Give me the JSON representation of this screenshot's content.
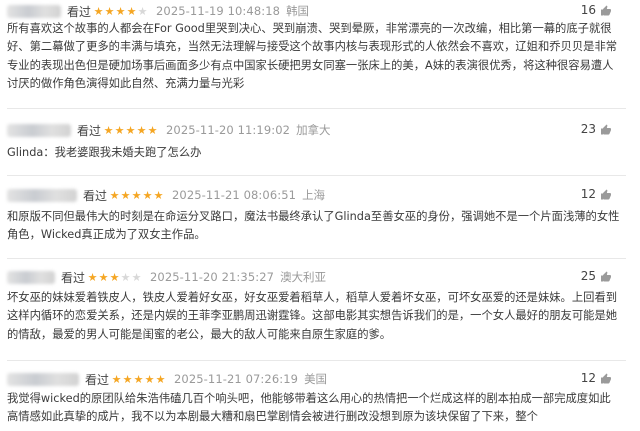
{
  "reviews": [
    {
      "watched_label": "看过",
      "rating": 4,
      "date": "2025-11-19 10:48:18",
      "location": "韩国",
      "likes": "16",
      "text": "所有喜欢这个故事的人都会在For Good里哭到决心、哭到崩溃、哭到晕厥，非常漂亮的一次改编，相比第一幕的底子就很好、第二幕做了更多的丰满与填充，当然无法理解与接受这个故事内核与表现形式的人依然会不喜欢，辽姐和乔贝贝是非常专业的表现出色但是硬加场事后画面多少有点中国家长硬把男女同塞一张床上的美，A妹的表演很优秀，将这种很容易遭人讨厌的做作角色演得如此自然、充满力量与光彩"
    },
    {
      "watched_label": "看过",
      "rating": 5,
      "date": "2025-11-20 11:19:02",
      "location": "加拿大",
      "likes": "23",
      "text": "Glinda：我老婆跟我未婚夫跑了怎么办"
    },
    {
      "watched_label": "看过",
      "rating": 5,
      "date": "2025-11-21 08:06:51",
      "location": "上海",
      "likes": "12",
      "text": "和原版不同但最伟大的时刻是在命运分叉路口，魔法书最终承认了Glinda至善女巫的身份，强调她不是一个片面浅薄的女性角色，Wicked真正成为了双女主作品。"
    },
    {
      "watched_label": "看过",
      "rating": 3,
      "date": "2025-11-20 21:35:27",
      "location": "澳大利亚",
      "likes": "25",
      "text": "坏女巫的妹妹爱着铁皮人，铁皮人爱着好女巫，好女巫爱着稻草人，稻草人爱着坏女巫，可坏女巫爱的还是妹妹。上回看到这样内循环的恋爱关系，还是内娱的王菲李亚鹏周迅谢霆锋。这部电影其实想告诉我们的是，一个女人最好的朋友可能是她的情敌，最爱的男人可能是闺蜜的老公，最大的敌人可能来自原生家庭的爹。"
    },
    {
      "watched_label": "看过",
      "rating": 5,
      "date": "2025-11-21 07:26:19",
      "location": "美国",
      "likes": "12",
      "text": "我觉得wicked的原团队给朱浩伟磕几百个响头吧，他能够带着这么用心的热情把一个烂成这样的剧本拍成一部完成度如此高情感如此真挚的成片，我不以为本剧最大糟和扇巴掌剧情会被进行删改没想到原为该块保留了下来，整个"
    }
  ]
}
